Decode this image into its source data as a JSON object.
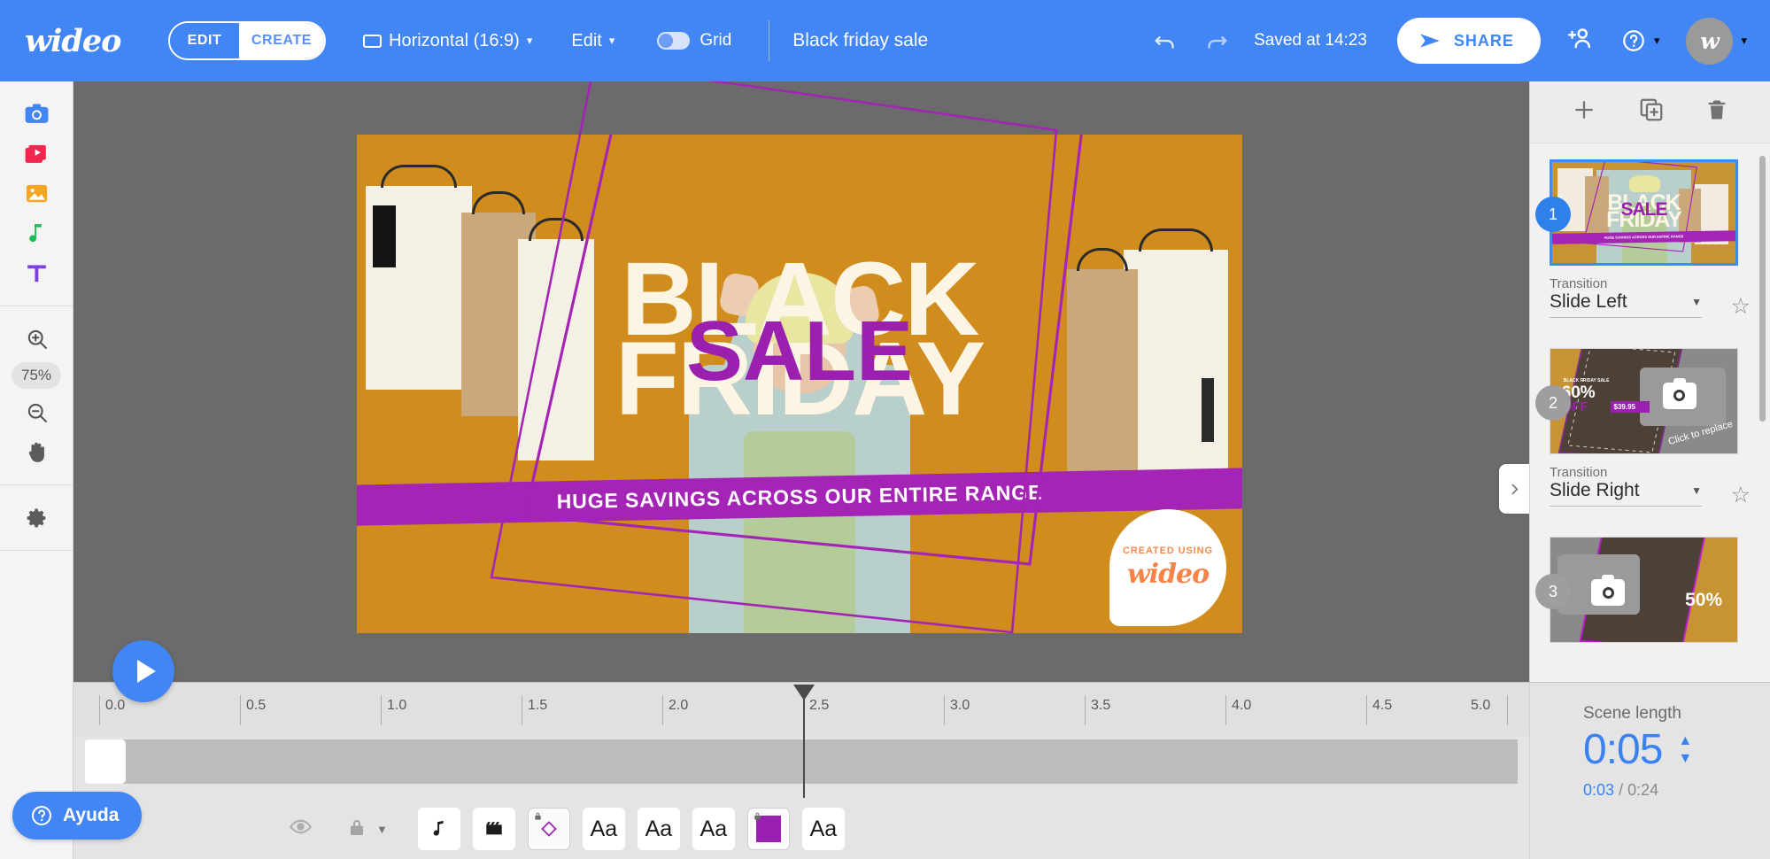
{
  "app": {
    "brand": "wideo",
    "accent": "#4285f4",
    "purple": "#9b20b0",
    "orange": "#d08d1d"
  },
  "topbar": {
    "mode_tabs": [
      {
        "label": "EDIT",
        "active": true
      },
      {
        "label": "CREATE",
        "active": false
      }
    ],
    "ratio_label": "Horizontal (16:9)",
    "edit_menu_label": "Edit",
    "grid_label": "Grid",
    "grid_enabled": false,
    "project_title": "Black friday sale",
    "saved_status": "Saved at 14:23",
    "share_label": "SHARE",
    "icons": {
      "ratio": "rectangle-icon",
      "undo": "undo-icon",
      "redo": "redo-icon",
      "share": "send-icon",
      "add_user": "add-user-icon",
      "help": "help-circle-icon",
      "avatar": "w"
    }
  },
  "rail": {
    "tools": [
      {
        "name": "camera-icon",
        "label": "Images"
      },
      {
        "name": "video-icon",
        "label": "Videos"
      },
      {
        "name": "picture-icon",
        "label": "Backgrounds"
      },
      {
        "name": "music-note-icon",
        "label": "Audio"
      },
      {
        "name": "text-icon",
        "label": "Text"
      }
    ],
    "zoom_in_label": "zoom-in-icon",
    "zoom_level": "75%",
    "zoom_out_label": "zoom-out-icon",
    "hand_label": "hand-tool-icon",
    "settings_label": "gear-icon"
  },
  "canvas": {
    "headline_line1": "BLACK",
    "headline_line2": "FRIDAY",
    "overlay_word": "SALE",
    "band_text": "HUGE SAVINGS ACROSS OUR ENTIRE RANGE",
    "badge_top": "CREATED USING",
    "badge_logo": "wideo",
    "collapse_icon": "chevron-right-icon"
  },
  "scene_panel": {
    "tools": [
      {
        "name": "add-scene-icon",
        "label": "+"
      },
      {
        "name": "duplicate-scene-icon",
        "label": "Duplicate"
      },
      {
        "name": "delete-scene-icon",
        "label": "Delete"
      }
    ],
    "transition_label": "Transition",
    "scenes": [
      {
        "number": "1",
        "selected": true,
        "transition": "Slide Left",
        "headline1": "BLACK",
        "headline2": "FRIDAY",
        "overlay_word": "SALE",
        "band_text": "HUGE SAVINGS ACROSS OUR ENTIRE RANGE"
      },
      {
        "number": "2",
        "selected": false,
        "transition": "Slide Right",
        "percent": "60%",
        "off": "OFF",
        "price": "$39.95",
        "replace_text": "Click to replace"
      },
      {
        "number": "3",
        "selected": false,
        "percent": "50%"
      }
    ]
  },
  "timeline": {
    "ticks": [
      "0.0",
      "0.5",
      "1.0",
      "1.5",
      "2.0",
      "2.5",
      "3.0",
      "3.5",
      "4.0",
      "4.5",
      "5.0"
    ],
    "playhead_time": "2.5",
    "play_icon": "play-icon",
    "layer_controls": {
      "eye": "eye-icon",
      "lock": "lock-icon",
      "caret": "chevron-down-icon"
    },
    "layers": [
      {
        "name": "audio-layer",
        "glyph": "music-note-icon",
        "locked": false
      },
      {
        "name": "video-layer",
        "glyph": "clapperboard-icon",
        "locked": false
      },
      {
        "name": "shape-layer",
        "glyph": "diamond-icon",
        "locked": true
      },
      {
        "name": "text-layer-1",
        "glyph": "Aa",
        "locked": false
      },
      {
        "name": "text-layer-2",
        "glyph": "Aa",
        "locked": false
      },
      {
        "name": "text-layer-3",
        "glyph": "Aa",
        "locked": false
      },
      {
        "name": "color-layer",
        "glyph": "swatch",
        "locked": true
      },
      {
        "name": "text-layer-4",
        "glyph": "Aa",
        "locked": false
      }
    ]
  },
  "scene_length": {
    "title": "Scene length",
    "value": "0:05",
    "current_time": "0:03",
    "separator": "/",
    "total_time": "0:24"
  },
  "help": {
    "label": "Ayuda",
    "icon": "question-circle-icon"
  }
}
